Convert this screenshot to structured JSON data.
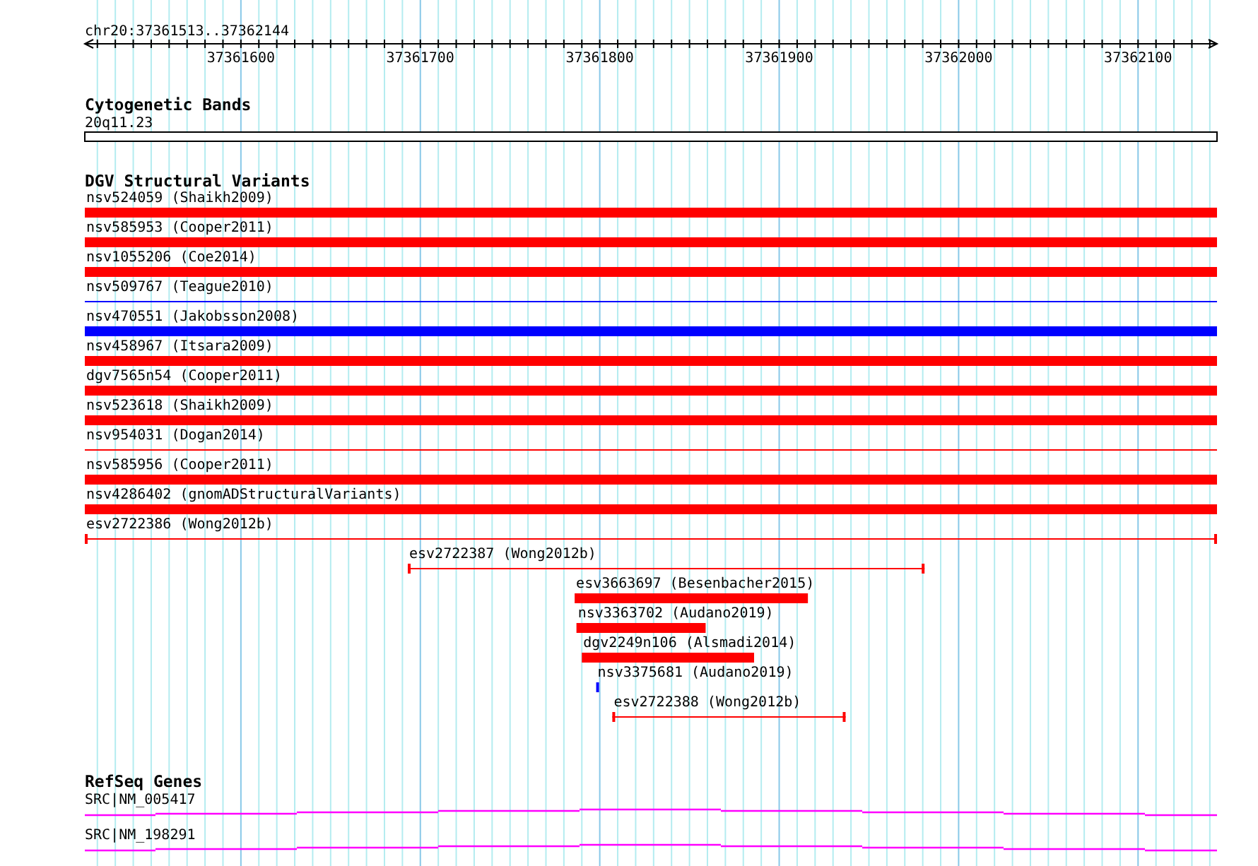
{
  "ruler": {
    "title": "chr20:37361513..37362144",
    "labels": [
      "37361600",
      "37361700",
      "37361800",
      "37361900",
      "37362000",
      "37362100"
    ]
  },
  "cytoband": {
    "title": "Cytogenetic Bands",
    "band": "20q11.23"
  },
  "dgv": {
    "title": "DGV Structural Variants",
    "features": [
      {
        "label": "nsv524059 (Shaikh2009)",
        "kind": "thick",
        "color": "#ff0000"
      },
      {
        "label": "nsv585953 (Cooper2011)",
        "kind": "thick",
        "color": "#ff0000"
      },
      {
        "label": "nsv1055206 (Coe2014)",
        "kind": "thick",
        "color": "#ff0000"
      },
      {
        "label": "nsv509767 (Teague2010)",
        "kind": "thin",
        "color": "#0000ff"
      },
      {
        "label": "nsv470551 (Jakobsson2008)",
        "kind": "thick",
        "color": "#0000ff"
      },
      {
        "label": "nsv458967 (Itsara2009)",
        "kind": "thick",
        "color": "#ff0000"
      },
      {
        "label": "dgv7565n54 (Cooper2011)",
        "kind": "thick",
        "color": "#ff0000"
      },
      {
        "label": "nsv523618 (Shaikh2009)",
        "kind": "thick",
        "color": "#ff0000"
      },
      {
        "label": "nsv954031 (Dogan2014)",
        "kind": "thin",
        "color": "#ff0000"
      },
      {
        "label": "nsv585956 (Cooper2011)",
        "kind": "thick",
        "color": "#ff0000"
      },
      {
        "label": "nsv4286402 (gnomADStructuralVariants)",
        "kind": "thick",
        "color": "#ff0000"
      },
      {
        "label": "esv2722386 (Wong2012b)",
        "kind": "bounded",
        "color": "#ff0000"
      },
      {
        "label": "esv2722387 (Wong2012b)",
        "kind": "bounded",
        "color": "#ff0000"
      },
      {
        "label": "esv3663697 (Besenbacher2015)",
        "kind": "thick",
        "color": "#ff0000"
      },
      {
        "label": "nsv3363702 (Audano2019)",
        "kind": "thick",
        "color": "#ff0000"
      },
      {
        "label": "dgv2249n106 (Alsmadi2014)",
        "kind": "thick",
        "color": "#ff0000"
      },
      {
        "label": "nsv3375681 (Audano2019)",
        "kind": "thick",
        "color": "#0000ff"
      },
      {
        "label": "esv2722388 (Wong2012b)",
        "kind": "bounded",
        "color": "#ff0000"
      }
    ]
  },
  "refseq": {
    "title": "RefSeq Genes",
    "genes": [
      {
        "label": "SRC|NM_005417"
      },
      {
        "label": "SRC|NM_198291"
      }
    ]
  }
}
